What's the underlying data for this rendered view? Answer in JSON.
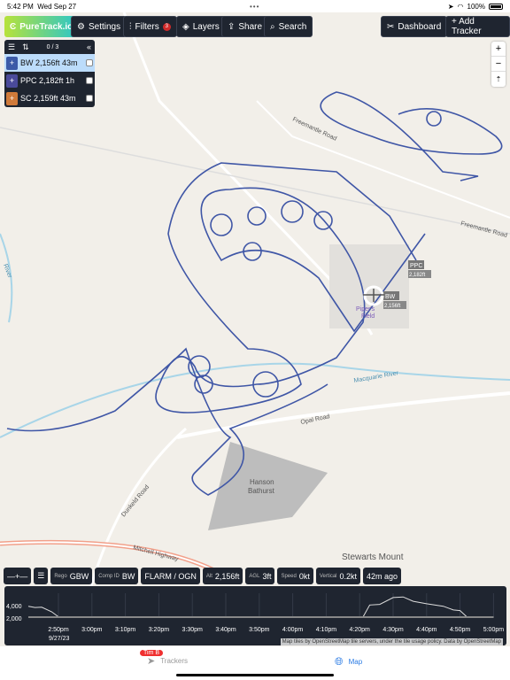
{
  "status": {
    "time": "5:42 PM",
    "date": "Wed Sep 27",
    "battery": "100%"
  },
  "toolbar": {
    "logo": "PureTrack.io",
    "settings": "Settings",
    "filters": "Filters",
    "filters_badge": "3",
    "layers": "Layers",
    "share": "Share",
    "search": "Search",
    "dashboard": "Dashboard",
    "add_tracker": "+ Add Tracker"
  },
  "tracker_panel": {
    "count": "0 / 3",
    "items": [
      {
        "label": "BW 2,156ft 43m",
        "color": "#3b5aa8",
        "selected": true
      },
      {
        "label": "PPC  2,182ft  1h",
        "color": "#4a4a9a",
        "selected": false
      },
      {
        "label": "SC 2,159ft 43m",
        "color": "#d07a3a",
        "selected": false
      }
    ]
  },
  "map_controls": {
    "zoom_in": "+",
    "zoom_out": "−",
    "compass": "⇡"
  },
  "map_labels": {
    "freemantle1": "Freemantle Road",
    "freemantle2": "Freemantle Road",
    "river_left": "River",
    "macquarie": "Macquarie River",
    "opal": "Opal Road",
    "dunkeld": "Dunkeld Road",
    "mitchell": "Mitchell Highway",
    "hanson1": "Hanson",
    "hanson2": "Bathurst",
    "stewarts": "Stewarts Mount",
    "field1": "Piper's",
    "field2": "Field",
    "tag_bw": "BW",
    "tag_bw_alt": "2,156ft",
    "tag_ppc": "PPC",
    "tag_ppc_alt": "2,182ft"
  },
  "track_color": "#3f56a6",
  "info": {
    "rego_label": "Rego",
    "rego": "GBW",
    "comp_label": "Comp ID",
    "comp": "BW",
    "source": "FLARM / OGN",
    "alt_label": "Alt",
    "alt": "2,156ft",
    "agl_label": "AGL",
    "agl": "3ft",
    "speed_label": "Speed",
    "speed": "0kt",
    "vert_label": "Vertical",
    "vert": "0.2kt",
    "ago": "42m ago"
  },
  "chart_data": {
    "type": "line",
    "xlabel": "",
    "ylabel": "",
    "date_label": "9/27/23",
    "y_ticks": [
      "4,000",
      "2,000"
    ],
    "x_ticks": [
      "2:50pm",
      "3:00pm",
      "3:10pm",
      "3:20pm",
      "3:30pm",
      "3:40pm",
      "3:50pm",
      "4:00pm",
      "4:10pm",
      "4:20pm",
      "4:30pm",
      "4:40pm",
      "4:50pm",
      "5:00pm"
    ],
    "series": [
      {
        "x": [
          "2:41pm",
          "2:43pm",
          "2:45pm",
          "2:48pm",
          "2:50pm",
          "4:21pm",
          "4:23pm",
          "4:26pm",
          "4:30pm",
          "4:33pm",
          "4:36pm",
          "4:40pm",
          "4:45pm",
          "4:48pm",
          "4:50pm",
          "4:52pm",
          "5:00pm"
        ],
        "values": [
          3900,
          3700,
          3750,
          3000,
          2200,
          2156,
          4100,
          4200,
          5300,
          5400,
          4700,
          4300,
          3900,
          3300,
          3200,
          2200,
          2156
        ]
      },
      {
        "x": [
          "2:41pm",
          "5:00pm"
        ],
        "values": [
          2150,
          2150
        ]
      }
    ]
  },
  "attribution": "Map tiles by OpenStreetMap tile servers, under the tile usage policy. Data by OpenStreetMap",
  "tabs": {
    "trackers": "Trackers",
    "trackers_badge": "Tim B",
    "map": "Map"
  }
}
